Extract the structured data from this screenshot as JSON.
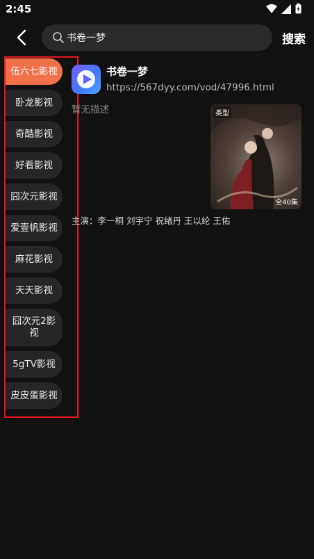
{
  "status_bar": {
    "time": "2:45"
  },
  "search": {
    "query": "书卷一梦",
    "button_label": "搜索"
  },
  "sources": [
    {
      "label": "伍六七影视",
      "active": true
    },
    {
      "label": "卧龙影视",
      "active": false
    },
    {
      "label": "奇酷影视",
      "active": false
    },
    {
      "label": "好看影视",
      "active": false
    },
    {
      "label": "囧次元影视",
      "active": false
    },
    {
      "label": "爱壹帆影视",
      "active": false
    },
    {
      "label": "麻花影视",
      "active": false
    },
    {
      "label": "天天影视",
      "active": false
    },
    {
      "label": "囧次元2影视",
      "active": false
    },
    {
      "label": "5gTV影视",
      "active": false
    },
    {
      "label": "皮皮蛋影视",
      "active": false
    }
  ],
  "result": {
    "title": "书卷一梦",
    "url": "https://567dyy.com/vod/47996.html",
    "description": "暂无描述",
    "poster_tag": "类型",
    "poster_episodes": "全40集",
    "cast": "主演：李一桐 刘宇宁 祝绪丹 王以纶 王佑"
  },
  "colors": {
    "accent": "#f2704a",
    "highlight": "#e8161b",
    "background": "#111112"
  }
}
